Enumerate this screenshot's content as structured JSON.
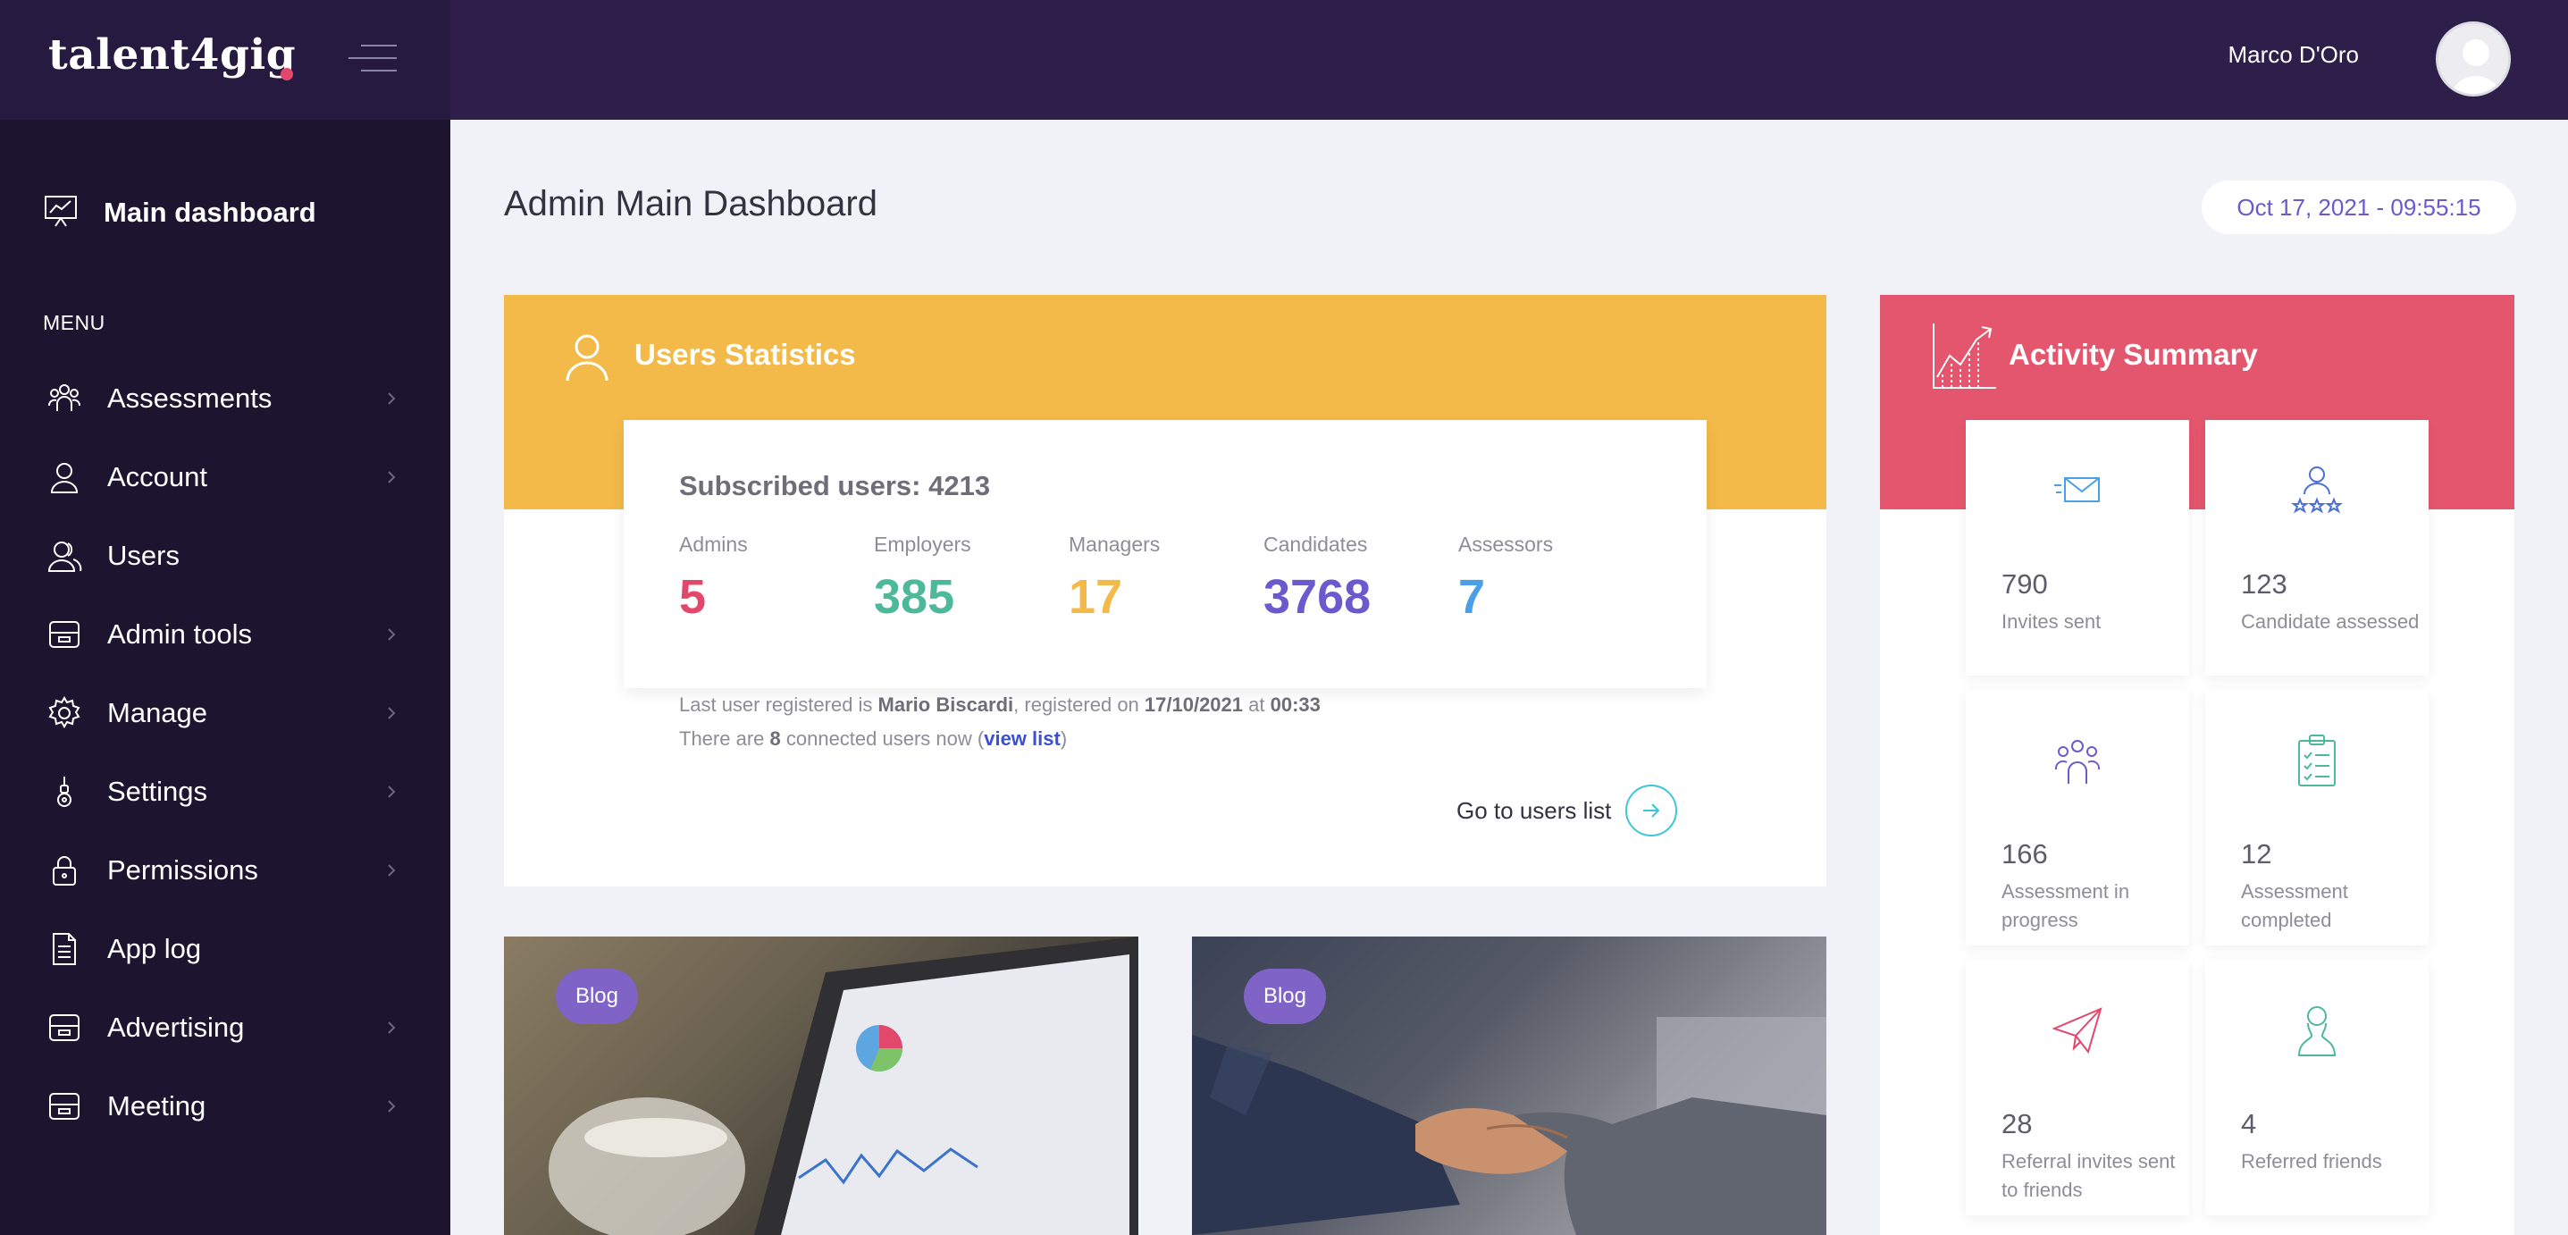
{
  "brand": {
    "logo_text": "talent4gig"
  },
  "sidebar": {
    "main_dashboard": "Main dashboard",
    "menu_title": "MENU",
    "items": [
      {
        "label": "Assessments",
        "icon": "assessments-icon",
        "has_children": true
      },
      {
        "label": "Account",
        "icon": "user-icon",
        "has_children": true
      },
      {
        "label": "Users",
        "icon": "users-icon",
        "has_children": false
      },
      {
        "label": "Admin tools",
        "icon": "archive-box-icon",
        "has_children": true
      },
      {
        "label": "Manage",
        "icon": "gear-icon",
        "has_children": true
      },
      {
        "label": "Settings",
        "icon": "settings-icon",
        "has_children": true
      },
      {
        "label": "Permissions",
        "icon": "lock-icon",
        "has_children": true
      },
      {
        "label": "App log",
        "icon": "document-icon",
        "has_children": false
      },
      {
        "label": "Advertising",
        "icon": "archive-box-icon",
        "has_children": true
      },
      {
        "label": "Meeting",
        "icon": "archive-box-icon",
        "has_children": true
      }
    ]
  },
  "header": {
    "user_name": "Marco D'Oro"
  },
  "main": {
    "title": "Admin Main Dashboard",
    "datetime": "Oct 17, 2021 - 09:55:15"
  },
  "users_stats": {
    "title": "Users Statistics",
    "subscribed": "Subscribed users: 4213",
    "stats": [
      {
        "label": "Admins",
        "value": "5",
        "color": "#e2486b"
      },
      {
        "label": "Employers",
        "value": "385",
        "color": "#4db89a"
      },
      {
        "label": "Managers",
        "value": "17",
        "color": "#f3ba49"
      },
      {
        "label": "Candidates",
        "value": "3768",
        "color": "#6a5acd"
      },
      {
        "label": "Assessors",
        "value": "7",
        "color": "#4a9fe6"
      }
    ],
    "last_user_prefix": "Last user registered is ",
    "last_user_name": "Mario Biscardi",
    "registered_on": ", registered on ",
    "reg_date": "17/10/2021",
    "at_text": " at ",
    "reg_time": "00:33",
    "connected_prefix": "There are ",
    "connected_count": "8",
    "connected_suffix": " connected users now (",
    "view_list": "view list",
    "close_paren": ")",
    "goto_label": "Go to users list"
  },
  "blogs": [
    {
      "badge": "Blog"
    },
    {
      "badge": "Blog"
    }
  ],
  "activity": {
    "title": "Activity Summary",
    "tiles": [
      {
        "value": "790",
        "label": "Invites sent",
        "icon": "envelope-icon",
        "color": "#4a9fe6"
      },
      {
        "value": "123",
        "label": "Candidate assessed",
        "icon": "user-rating-icon",
        "color": "#4a6fd6"
      },
      {
        "value": "166",
        "label": "Assessment in progress",
        "icon": "team-icon",
        "color": "#6a5acd"
      },
      {
        "value": "12",
        "label": "Assessment completed",
        "icon": "clipboard-icon",
        "color": "#4db89a"
      },
      {
        "value": "28",
        "label": "Referral invites sent to friends",
        "icon": "paper-plane-icon",
        "color": "#e2486b"
      },
      {
        "value": "4",
        "label": "Referred friends",
        "icon": "person-icon",
        "color": "#4db89a"
      }
    ]
  }
}
